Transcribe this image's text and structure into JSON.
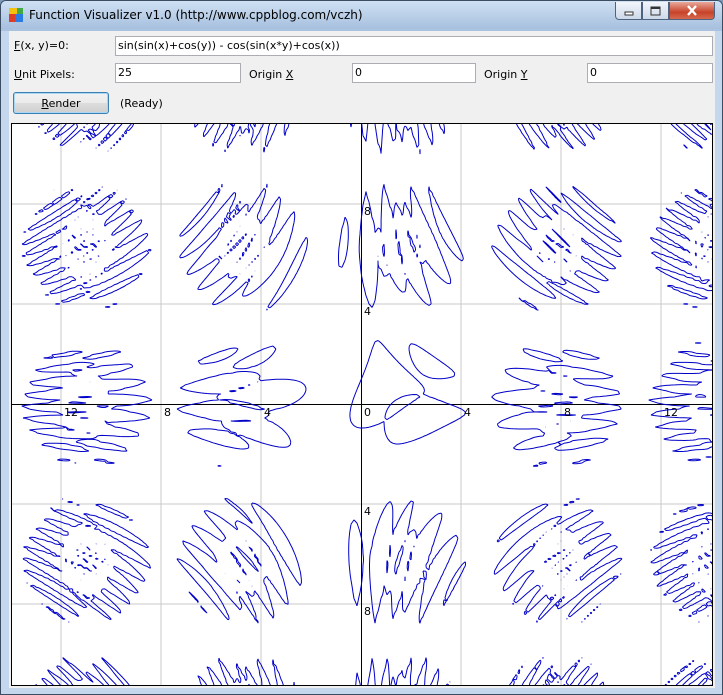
{
  "window": {
    "title": "Function Visualizer v1.0 (http://www.cppblog.com/vczh)"
  },
  "form": {
    "function_label": {
      "key": "F",
      "rest": "(x, y)=0:"
    },
    "function_value": "sin(sin(x)+cos(y)) - cos(sin(x*y)+cos(x))",
    "unit_label": {
      "key": "U",
      "rest": "nit Pixels:"
    },
    "unit_value": "25",
    "origin_x_label": {
      "pre": "Origin ",
      "key": "X"
    },
    "origin_x_value": "0",
    "origin_y_label": {
      "pre": "Origin ",
      "key": "Y"
    },
    "origin_y_value": "0",
    "render_label": {
      "key": "R",
      "rest": "ender"
    },
    "status": "(Ready)"
  },
  "plot": {
    "unit_pixels": 25,
    "origin": [
      0,
      0
    ],
    "grid_step": 4,
    "x_tick_labels": [
      "12",
      "8",
      "4",
      "0",
      "4",
      "8",
      "12"
    ],
    "y_tick_labels": [
      "8",
      "4",
      "4",
      "8"
    ],
    "colors": {
      "grid": "#c8c8c8",
      "axis": "#000000",
      "curve": "#0000c8"
    }
  }
}
